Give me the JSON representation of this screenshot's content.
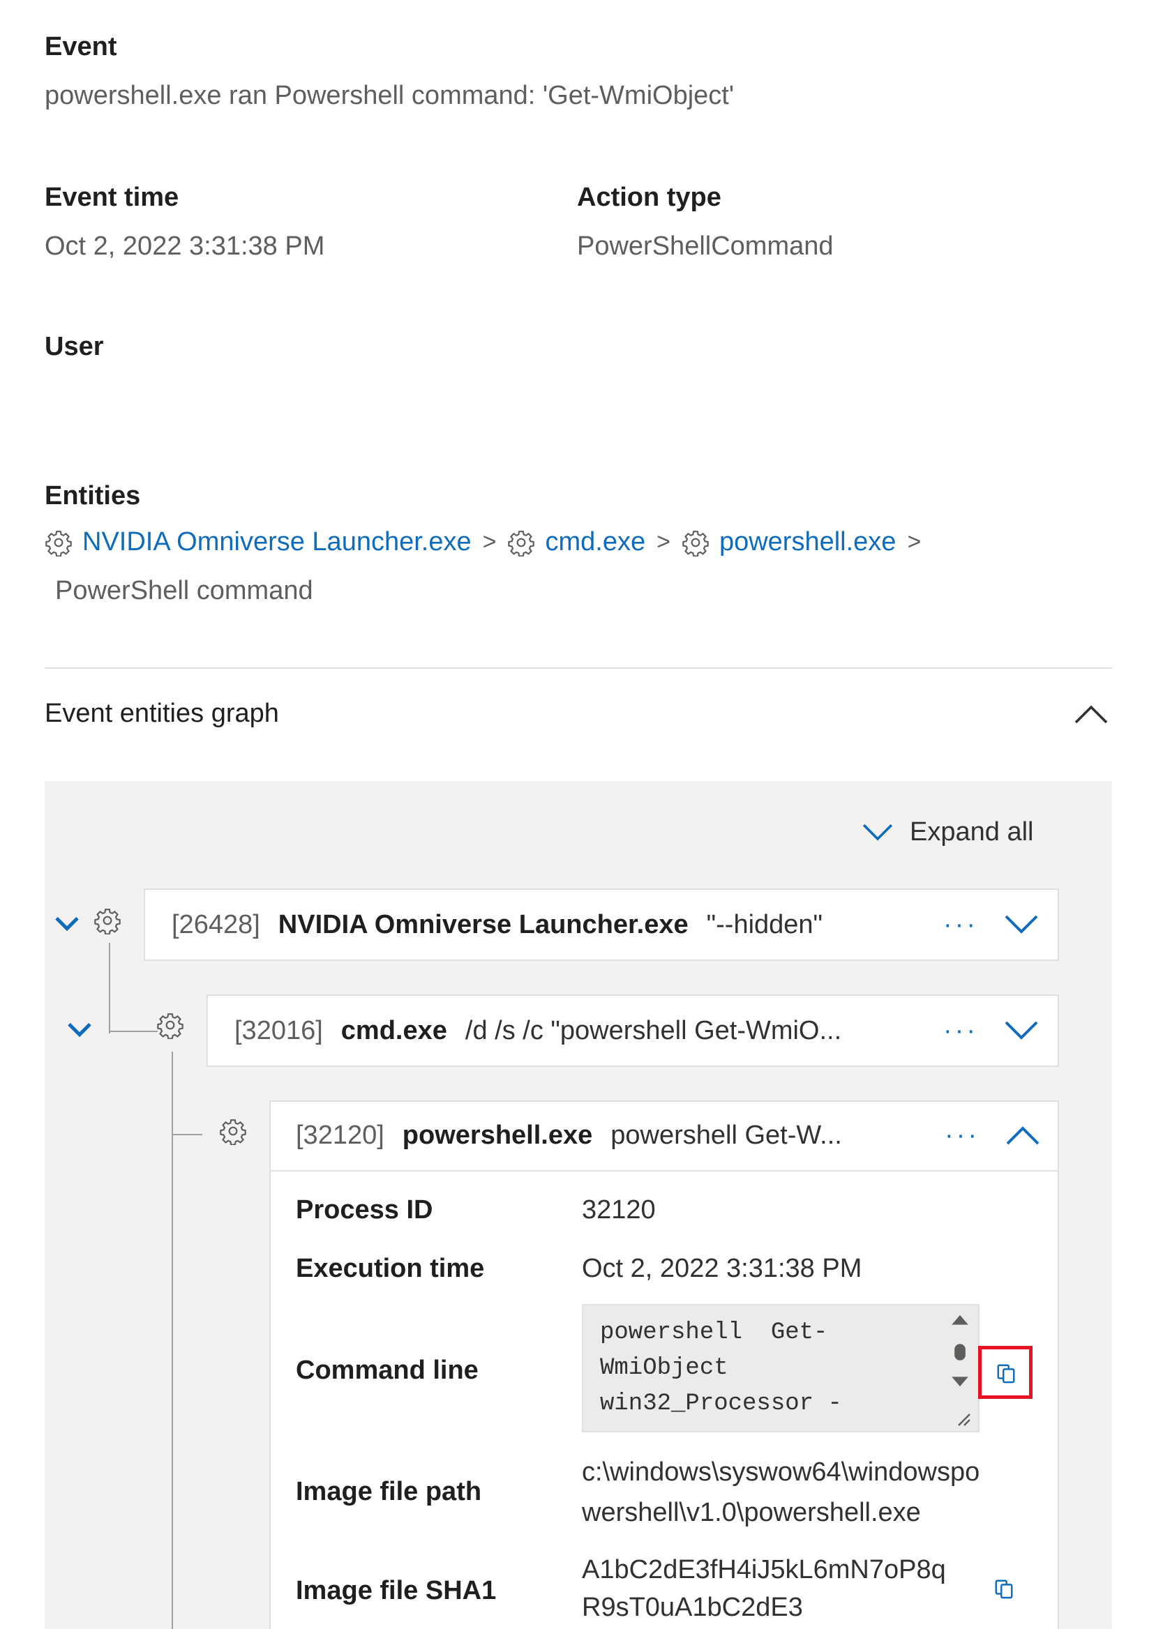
{
  "event": {
    "label": "Event",
    "value": "powershell.exe ran Powershell command: 'Get-WmiObject'"
  },
  "event_time": {
    "label": "Event time",
    "value": "Oct 2, 2022 3:31:38 PM"
  },
  "action_type": {
    "label": "Action type",
    "value": "PowerShellCommand"
  },
  "user": {
    "label": "User",
    "value": ""
  },
  "entities": {
    "label": "Entities",
    "items": [
      "NVIDIA Omniverse Launcher.exe",
      "cmd.exe",
      "powershell.exe"
    ],
    "separator": ">",
    "last": "PowerShell command"
  },
  "graph": {
    "title": "Event entities graph",
    "expand_all": "Expand all",
    "more": "···",
    "nodes": [
      {
        "pid": "[26428]",
        "name": "NVIDIA Omniverse Launcher.exe",
        "args": "\"--hidden\""
      },
      {
        "pid": "[32016]",
        "name": "cmd.exe",
        "args": "/d /s /c \"powershell Get-WmiO..."
      },
      {
        "pid": "[32120]",
        "name": "powershell.exe",
        "args": "powershell Get-W..."
      }
    ],
    "details": {
      "process_id": {
        "label": "Process ID",
        "value": "32120"
      },
      "execution_time": {
        "label": "Execution time",
        "value": "Oct 2, 2022 3:31:38 PM"
      },
      "command_line": {
        "label": "Command line",
        "lines": [
          "powershell  Get-",
          "WmiObject",
          "win32_Processor -"
        ]
      },
      "image_file_path": {
        "label": "Image file path",
        "lines": [
          "c:\\windows\\syswow64\\windowspo",
          "wershell\\v1.0\\powershell.exe"
        ]
      },
      "image_file_sha1": {
        "label": "Image file SHA1",
        "lines": [
          "A1bC2dE3fH4iJ5kL6mN7oP8q",
          "R9sT0uA1bC2dE3"
        ]
      }
    }
  },
  "icons": {
    "process": "gear-icon",
    "collapse": "chevron-up-icon",
    "expand": "chevron-down-icon",
    "copy": "copy-icon"
  },
  "colors": {
    "link": "#0f6cbd",
    "highlight": "#e81123",
    "panel": "#f3f2f1"
  }
}
